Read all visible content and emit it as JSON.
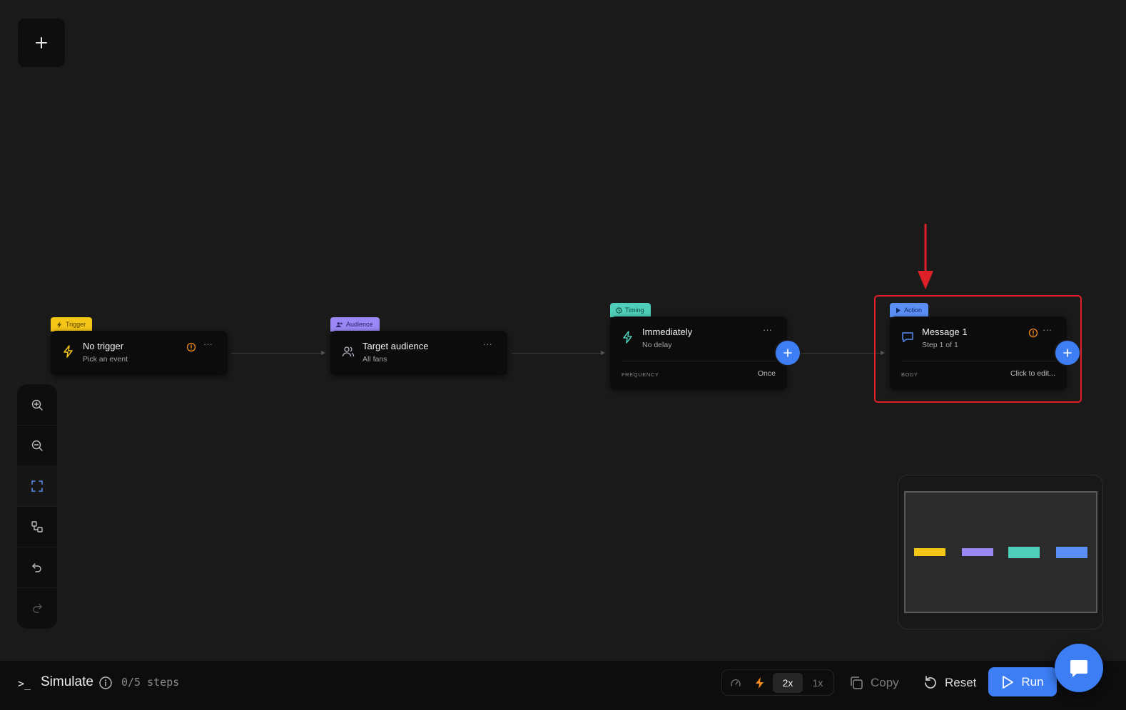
{
  "canvas": {
    "add_button_label": "+"
  },
  "nodes": [
    {
      "kind": "trigger",
      "tag": "Trigger",
      "tag_color": "#f5c518",
      "title": "No trigger",
      "subtitle": "Pick an event",
      "has_warning": true,
      "icon": "lightning-icon"
    },
    {
      "kind": "audience",
      "tag": "Audience",
      "tag_color": "#9b87f5",
      "title": "Target audience",
      "subtitle": "All fans",
      "has_warning": false,
      "icon": "users-icon"
    },
    {
      "kind": "timing",
      "tag": "Timing",
      "tag_color": "#4ecdb8",
      "title": "Immediately",
      "subtitle": "No delay",
      "footer_label": "FREQUENCY",
      "footer_value": "Once",
      "has_warning": false,
      "icon": "lightning-icon"
    },
    {
      "kind": "action",
      "tag": "Action",
      "tag_color": "#5b8ff5",
      "title": "Message 1",
      "subtitle": "Step 1 of 1",
      "footer_label": "BODY",
      "footer_value": "Click to edit...",
      "has_warning": true,
      "icon": "chat-bubble-icon"
    }
  ],
  "toolbar": {
    "tools": [
      "zoom-in-icon",
      "zoom-out-icon",
      "fit-view-icon",
      "auto-layout-icon",
      "undo-icon",
      "redo-icon"
    ],
    "active": "fit-view-icon"
  },
  "minimap": {
    "node_colors": [
      "#f5c518",
      "#9b87f5",
      "#4ecdb8",
      "#5b8ff5"
    ]
  },
  "simulate": {
    "prompt": ">_",
    "title": "Simulate",
    "steps": "0/5 steps"
  },
  "speed": {
    "options": [
      "2x",
      "1x"
    ],
    "selected": "2x"
  },
  "actions": {
    "copy_label": "Copy",
    "reset_label": "Reset",
    "run_label": "Run"
  },
  "colors": {
    "accent": "#3d7ef5",
    "highlight": "#e02028",
    "warning": "#f5891f"
  }
}
